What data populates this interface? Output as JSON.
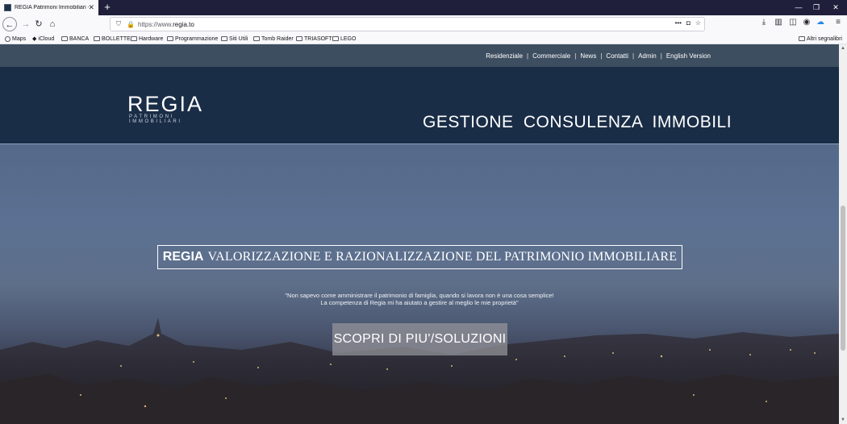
{
  "browser": {
    "tab_title": "REGIA Patrimoni Immobiliari - ",
    "url_scheme": "https://www.",
    "url_domain": "regia.to",
    "bookmarks": [
      "Maps",
      "iCloud",
      "BANCA",
      "BOLLETTE",
      "Hardware",
      "Programmazione",
      "Siti Utili",
      "Tomb Raider",
      "TRIASOFT",
      "LEGO"
    ],
    "other_bookmarks": "Altri segnalibri"
  },
  "site": {
    "topnav": [
      "Residenziale",
      "Commerciale",
      "News",
      "Contatti",
      "Admin",
      "English Version"
    ],
    "logo_text": "REGIA",
    "logo_subtitle": "PATRIMONI IMMOBILIARI",
    "tagline": "GESTIONE  CONSULENZA  IMMOBILI",
    "hero_brand": "REGIA",
    "hero_claim": "VALORIZZAZIONE E RAZIONALIZZAZIONE DEL PATRIMONIO IMMOBILIARE",
    "quote_line1": "\"Non sapevo come amministrare il patrimonio di famiglia, quando si lavora non è una cosa semplice!",
    "quote_line2": "La competenza di Regia mi ha aiutato a gestire al meglio le mie proprietà\"",
    "cta_label": "SCOPRI DI PIU'/SOLUZIONI"
  },
  "colors": {
    "topnav_bg": "#3d4e60",
    "header_bg": "#1a2d47",
    "titlebar_bg": "#1f1f3b"
  }
}
